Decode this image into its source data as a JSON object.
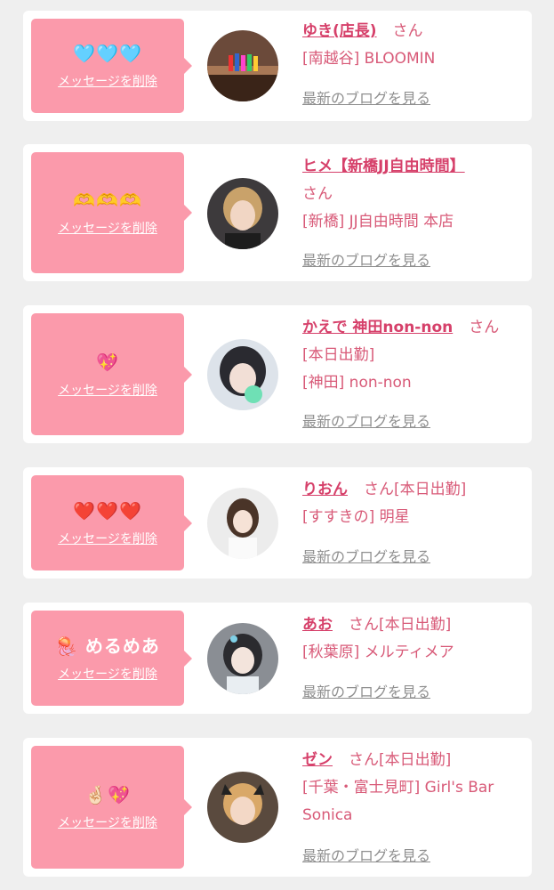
{
  "delete_label": "メッセージを削除",
  "blog_label": "最新のブログを見る",
  "honorific": "さん",
  "cards": [
    {
      "message": "🩵🩵🩵",
      "name": "ゆき(店長)",
      "status": "",
      "area": "[南越谷]",
      "shop": "BLOOMIN"
    },
    {
      "message": "🫶🫶🫶",
      "name": "ヒメ【新橋JJ自由時間】",
      "status": "",
      "area": "[新橋]",
      "shop": "JJ自由時間 本店"
    },
    {
      "message": "💖",
      "name": "かえで 神田non-non",
      "status": "[本日出勤]",
      "area": "[神田]",
      "shop": "non-non"
    },
    {
      "message": "❤️❤️❤️",
      "name": "りおん",
      "status": "[本日出勤]",
      "area": "[すすきの]",
      "shop": "明星"
    },
    {
      "message": "🪼 めるめあ",
      "name": "あお",
      "status": "[本日出勤]",
      "area": "[秋葉原]",
      "shop": "メルティメア"
    },
    {
      "message": "🤞🏻💖",
      "name": "ゼン",
      "status": "[本日出勤]",
      "area": "[千葉・富士見町]",
      "shop": "Girl's Bar Sonica"
    }
  ],
  "colors": {
    "background": "#efefef",
    "bubble": "#fb9aab",
    "name": "#d6406a",
    "text": "#d85a78",
    "link_gray": "#8f8f8f"
  }
}
